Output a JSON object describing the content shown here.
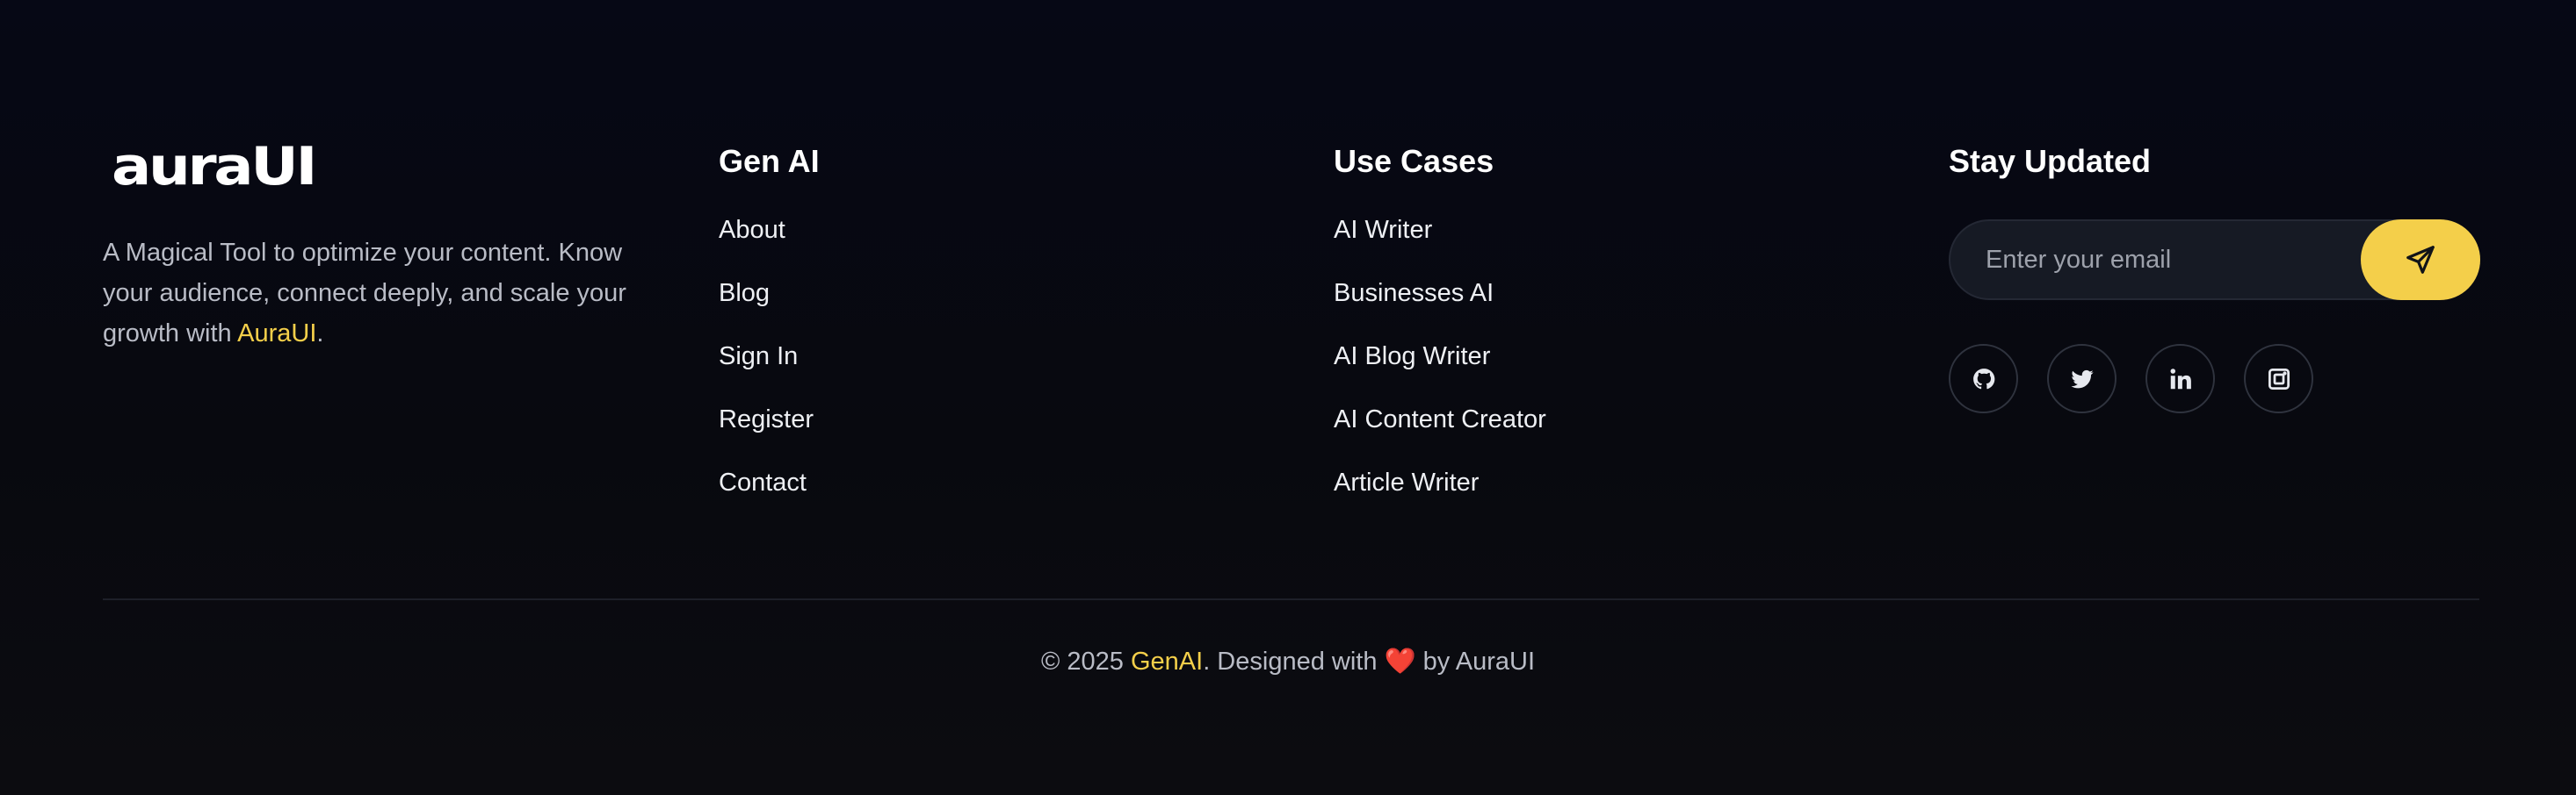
{
  "brand": {
    "logo_text": "auraUI",
    "description_prefix": "A Magical Tool to optimize your content. Know your audience, connect deeply, and scale your growth with ",
    "description_link": "AuraUI",
    "description_suffix": "."
  },
  "gen_ai": {
    "title": "Gen AI",
    "links": [
      {
        "label": "About"
      },
      {
        "label": "Blog"
      },
      {
        "label": "Sign In"
      },
      {
        "label": "Register"
      },
      {
        "label": "Contact"
      }
    ]
  },
  "use_cases": {
    "title": "Use Cases",
    "links": [
      {
        "label": "AI Writer"
      },
      {
        "label": "Businesses AI"
      },
      {
        "label": "AI Blog Writer"
      },
      {
        "label": "AI Content Creator"
      },
      {
        "label": "Article Writer"
      }
    ]
  },
  "stay_updated": {
    "title": "Stay Updated",
    "email_placeholder": "Enter your email",
    "send_icon": "send-icon",
    "socials": [
      {
        "icon": "github-icon"
      },
      {
        "icon": "twitter-icon"
      },
      {
        "icon": "linkedin-icon"
      },
      {
        "icon": "instagram-icon"
      }
    ]
  },
  "footer_bottom": {
    "copyright_prefix": "© 2025 ",
    "brand": "GenAI",
    "designed_with": ". Designed with ",
    "heart": "❤️",
    "by": " by AuraUI"
  },
  "colors": {
    "background": "#07080f",
    "accent": "#f4cf4a",
    "text": "#e6e8ee",
    "muted": "#b9bcc6"
  }
}
